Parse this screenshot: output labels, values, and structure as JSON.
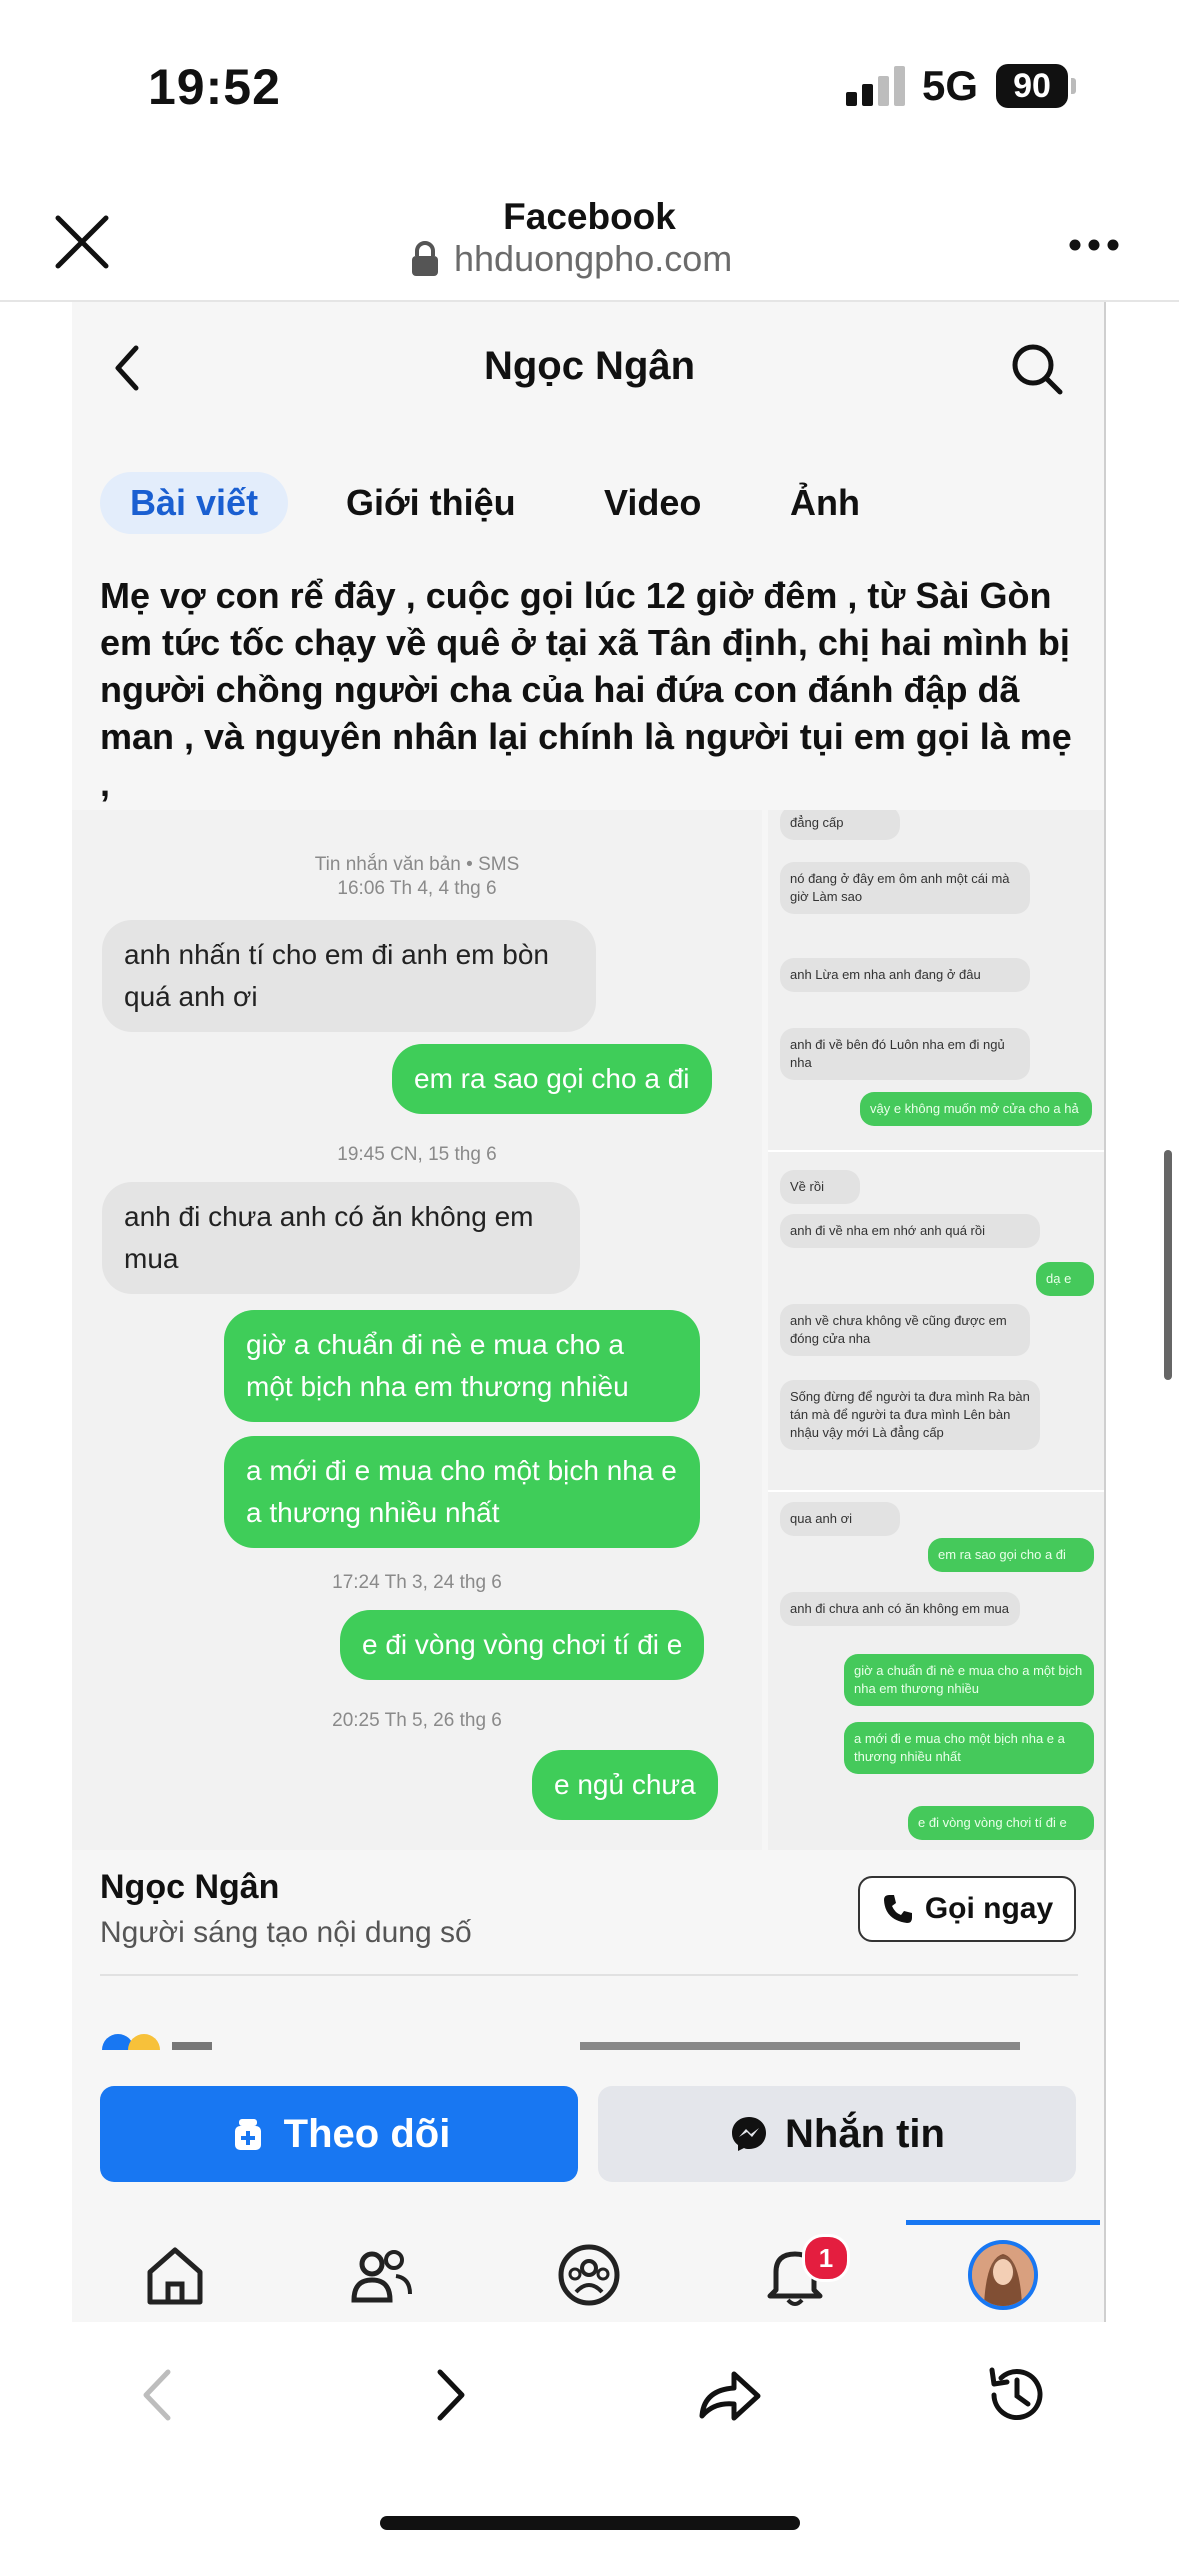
{
  "status_bar": {
    "time": "19:52",
    "network": "5G",
    "battery": "90"
  },
  "browser": {
    "title": "Facebook",
    "url": "hhduongpho.com"
  },
  "profile_header": {
    "name": "Ngọc Ngân"
  },
  "tabs": [
    {
      "label": "Bài viết",
      "active": true
    },
    {
      "label": "Giới thiệu",
      "active": false
    },
    {
      "label": "Video",
      "active": false
    },
    {
      "label": "Ảnh",
      "active": false
    }
  ],
  "post": {
    "text": "Mẹ vợ con rể đây , cuộc gọi lúc 12 giờ đêm , từ Sài Gòn em tức tốc chạy về quê ở tại xã Tân định, chị hai mình bị người chồng người cha của hai đứa con đánh đập dã man , và nguyên nhân lại chính là người tụi em gọi là mẹ ,"
  },
  "chat_main": {
    "meta1": "Tin nhắn văn bản • SMS",
    "meta1b": "16:06 Th 4, 4 thg 6",
    "m1": "anh nhấn tí cho em đi anh em bòn quá anh ơi",
    "m2": "em ra sao gọi cho a đi",
    "meta2": "19:45 CN, 15 thg 6",
    "m3": "anh đi chưa anh có ăn không em mua",
    "m4": "giờ a chuẩn đi nè e mua cho a một bịch nha em thương nhiều",
    "m5": "a mới đi e mua cho một bịch nha e a thương nhiều nhất",
    "meta3": "17:24 Th 3, 24 thg 6",
    "m6": "e đi vòng vòng chơi tí đi e",
    "meta4": "20:25 Th 5, 26 thg 6",
    "m7": "e ngủ chưa"
  },
  "chat_side": {
    "p1": [
      {
        "dir": "in",
        "text": "đẳng cấp"
      },
      {
        "dir": "in",
        "text": "nó đang ở đây em ôm anh một cái mà giờ Làm sao"
      },
      {
        "dir": "in",
        "text": "anh Lừa em nha anh đang ở đâu"
      },
      {
        "dir": "in",
        "text": "anh đi về bên đó Luôn nha em đi ngủ nha"
      },
      {
        "dir": "out",
        "text": "vậy e không muốn mở cửa cho a hả"
      }
    ],
    "p2": [
      {
        "dir": "in",
        "text": "Về rồi"
      },
      {
        "dir": "in",
        "text": "anh đi về nha em nhớ anh quá rồi"
      },
      {
        "dir": "out",
        "text": "dạ e"
      },
      {
        "dir": "in",
        "text": "anh về chưa  không về cũng được em đóng cửa nha"
      },
      {
        "dir": "in",
        "text": "Sống đừng để người ta đưa mình Ra bàn tán mà để người ta đưa mình Lên bàn nhậu vậy mới Là đẳng cấp"
      }
    ],
    "p3": [
      {
        "dir": "in",
        "text": "qua anh ơi"
      },
      {
        "dir": "out",
        "text": "em ra sao gọi cho a đi"
      },
      {
        "dir": "in",
        "text": "anh đi chưa anh có ăn không em mua"
      },
      {
        "dir": "out",
        "text": "giờ a chuẩn đi nè e mua cho a một bịch nha em thương nhiều"
      },
      {
        "dir": "out",
        "text": "a mới đi e mua cho một bịch nha e a thương nhiều nhất"
      },
      {
        "dir": "out",
        "text": "e đi vòng vòng chơi tí đi e"
      }
    ]
  },
  "profile": {
    "name": "Ngọc Ngân",
    "subtitle": "Người sáng tạo nội dung số",
    "call_label": "Gọi ngay"
  },
  "actions": {
    "follow": "Theo dõi",
    "message": "Nhắn tin"
  },
  "fb_nav": {
    "notification_count": "1"
  },
  "colors": {
    "fb_blue": "#1877f2",
    "imessage_green": "#3fcd59",
    "badge_red": "#e41e3f"
  },
  "icons": [
    "close-icon",
    "lock-icon",
    "more-icon",
    "back-icon",
    "search-icon",
    "phone-icon",
    "follow-icon",
    "messenger-icon",
    "home-icon",
    "friends-icon",
    "groups-icon",
    "bell-icon",
    "avatar",
    "chevron-left-icon",
    "chevron-right-icon",
    "share-icon",
    "history-icon"
  ]
}
